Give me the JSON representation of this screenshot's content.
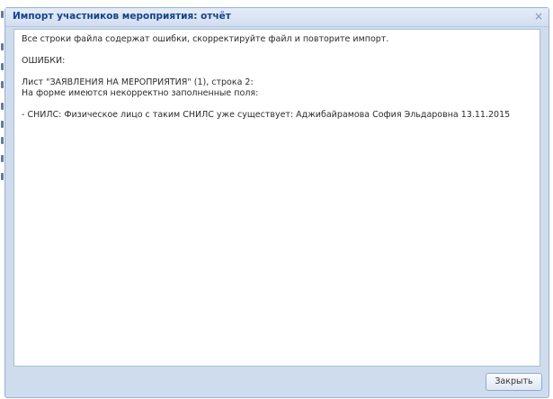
{
  "dialog": {
    "title": "Импорт участников мероприятия: отчёт",
    "close_glyph": "×",
    "close_button_label": "Закрыть"
  },
  "report": {
    "summary": "Все строки файла содержат ошибки, скорректируйте файл и повторите импорт.",
    "errors_heading": "ОШИБКИ:",
    "sheet_line": "Лист \"ЗАЯВЛЕНИЯ НА МЕРОПРИЯТИЯ\" (1), строка 2:",
    "form_note": "На форме имеются некорректно заполненные поля:",
    "error_detail": "- СНИЛС: Физическое лицо с таким СНИЛС уже существует: Аджибайрамова София Эльдаровна 13.11.2015"
  },
  "colors": {
    "window_bg": "#cfdcee",
    "title_text": "#15428b",
    "border": "#99b1d2"
  }
}
